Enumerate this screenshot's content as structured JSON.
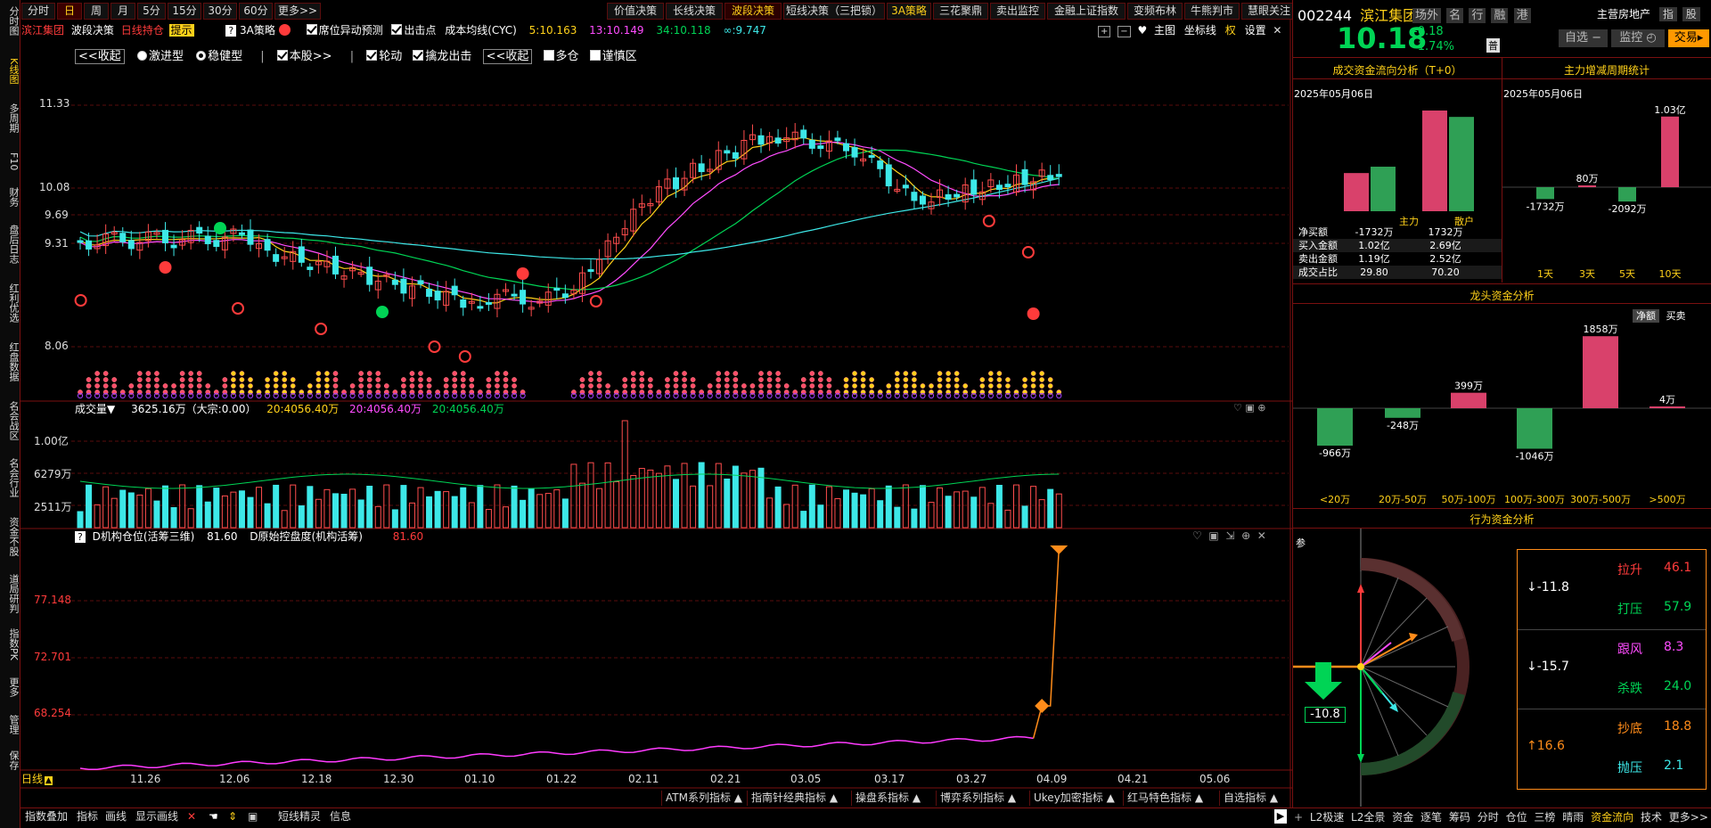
{
  "left_strip": [
    "分时图",
    "K线图",
    "多周期",
    "F10",
    "财务",
    "盘后日志",
    "红利优选",
    "红盘数据",
    "名会战区",
    "名会行业",
    "资金不股",
    "道局研判",
    "指数PK",
    "更多",
    "管理",
    "保存"
  ],
  "period_tabs": [
    "分时",
    "日",
    "周",
    "月",
    "5分",
    "15分",
    "30分",
    "60分",
    "更多>>"
  ],
  "decision_tabs": [
    "价值决策",
    "长线决策",
    "波段决策",
    "短线决策（三把锁）",
    "3A策略",
    "三花聚鼎",
    "卖出监控",
    "金融上证指数",
    "变频布林",
    "牛熊判市",
    "慧眼关注"
  ],
  "chart_header": {
    "stock_name": "滨江集团",
    "item1": "波段决策",
    "item2": "日线持仓",
    "tip": "提示",
    "strategy": "3A策略",
    "check_seat": "席位异动预测",
    "check_out": "出击点",
    "cost_label": "成本均线(CYC)",
    "ma5": "5:10.163",
    "ma13": "13:10.149",
    "ma34": "34:10.118",
    "mainf": "∞:9.747",
    "main_chart": "主图",
    "coord": "坐标线",
    "right": "权",
    "settings": "设置"
  },
  "options_row": {
    "collapse1": "<<收起",
    "radio1": "激进型",
    "radio2": "稳健型",
    "stock": "本股>>",
    "rotate": "轮动",
    "dragon": "擒龙出击",
    "collapse2": "<<收起",
    "multi": "多仓",
    "caution": "谨慎区"
  },
  "price_axis": [
    "11.33",
    "10.08",
    "9.69",
    "9.31",
    "8.06"
  ],
  "volume_header": {
    "label": "成交量▼",
    "value": "3625.16万（大宗:0.00）",
    "ma1": "20:4056.40万",
    "ma2": "20:4056.40万",
    "ma3": "20:4056.40万"
  },
  "volume_axis": [
    "1.00亿",
    "6279万",
    "2511万"
  ],
  "indicator_header": {
    "label1": "D机构仓位(活筹三维)",
    "value1": "81.60",
    "label2": "D原始控盘度(机构活筹)",
    "value2": "81.60"
  },
  "indicator_axis": [
    "77.148",
    "72.701",
    "68.254"
  ],
  "date_axis": [
    "11.26",
    "12.06",
    "12.18",
    "12.30",
    "01.10",
    "01.22",
    "02.11",
    "02.21",
    "03.05",
    "03.17",
    "03.27",
    "04.09",
    "04.21",
    "05.06"
  ],
  "period_label": "日线",
  "indicator_tabs": [
    "ATM系列指标",
    "指南针经典指标",
    "操盘系指标",
    "博弈系列指标",
    "Ukey加密指标",
    "红马特色指标",
    "自选指标"
  ],
  "bottom_tools": [
    "指数叠加",
    "指标",
    "画线",
    "显示画线"
  ],
  "bottom_tools2": [
    "短线精灵",
    "信息"
  ],
  "quote": {
    "code": "002244",
    "name": "滨江集团",
    "tags": [
      "场外",
      "名",
      "行",
      "融",
      "港"
    ],
    "industry": "主营房地产",
    "index_btn": "指",
    "stock_btn": "股",
    "price": "10.18",
    "change": "-0.18",
    "pct": "-1.74%",
    "badge": "普",
    "select_btn": "自选 −",
    "monitor_btn": "监控",
    "trade_btn": "交易"
  },
  "flow_panel": {
    "title": "成交资金流向分析（T+0）",
    "date": "2025年05月06日",
    "bar_labels": [
      "主力",
      "散户"
    ],
    "rows": [
      {
        "k": "净买额",
        "a": "-1732万",
        "b": "1732万"
      },
      {
        "k": "买入金额",
        "a": "1.02亿",
        "b": "2.69亿"
      },
      {
        "k": "卖出金额",
        "a": "1.19亿",
        "b": "2.52亿"
      },
      {
        "k": "成交占比",
        "a": "29.80",
        "b": "70.20"
      }
    ],
    "main_buy": 1.02,
    "main_sell": 1.19,
    "retail_buy": 2.69,
    "retail_sell": 2.52
  },
  "cycle_panel": {
    "title": "主力增减周期统计",
    "date": "2025年05月06日",
    "labels": [
      "1天",
      "3天",
      "5天",
      "10天"
    ],
    "values": [
      "-1732万",
      "80万",
      "-2092万",
      "1.03亿"
    ],
    "nums": [
      -1732,
      80,
      -2092,
      10300
    ]
  },
  "dragon_panel": {
    "title": "龙头资金分析",
    "tab1": "净额",
    "tab2": "买卖",
    "labels": [
      "<20万",
      "20万-50万",
      "50万-100万",
      "100万-300万",
      "300万-500万",
      ">500万"
    ],
    "values": [
      "-966万",
      "-248万",
      "399万",
      "-1046万",
      "1858万",
      "4万"
    ],
    "nums": [
      -966,
      -248,
      399,
      -1046,
      1858,
      4
    ]
  },
  "behavior_panel": {
    "title": "行为资金分析",
    "ref": "参",
    "arrow_value": "-10.8",
    "groups": [
      {
        "arrow": "↓-11.8",
        "items": [
          {
            "k": "拉升",
            "v": "46.1",
            "c": "#ff3b3b"
          },
          {
            "k": "打压",
            "v": "57.9",
            "c": "#00d455"
          }
        ]
      },
      {
        "arrow": "↓-15.7",
        "items": [
          {
            "k": "跟风",
            "v": "8.3",
            "c": "#ff4cff"
          },
          {
            "k": "杀跌",
            "v": "24.0",
            "c": "#00d455"
          }
        ]
      },
      {
        "arrow": "↑16.6",
        "items": [
          {
            "k": "抄底",
            "v": "18.8",
            "c": "#ff8c1a"
          },
          {
            "k": "抛压",
            "v": "2.1",
            "c": "#3de8e8"
          }
        ]
      }
    ]
  },
  "bottom_right_tabs": [
    "L2极速",
    "L2全景",
    "资金",
    "逐笔",
    "筹码",
    "分时",
    "仓位",
    "三榜",
    "晴雨",
    "资金流向",
    "技术",
    "更多>>"
  ]
}
